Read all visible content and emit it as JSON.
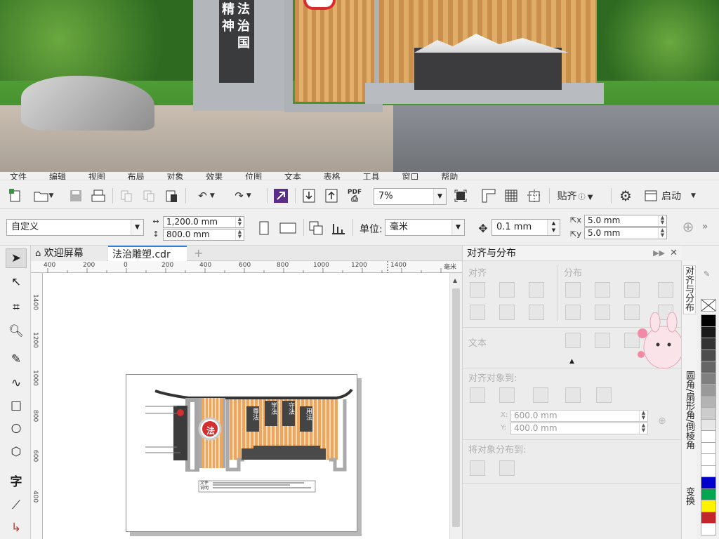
{
  "photo": {
    "slogan_lines": [
      "精",
      "神"
    ],
    "slogan_lines2": [
      "法",
      "治",
      "国"
    ]
  },
  "menubar": {
    "items": [
      "文件",
      "编辑",
      "视图",
      "布局",
      "对象",
      "效果",
      "位图",
      "文本",
      "表格",
      "工具",
      "窗口",
      "帮助"
    ]
  },
  "toolbar": {
    "zoom_value": "7%",
    "snap_label": "贴齐",
    "launch_label": "启动",
    "pdf_label": "PDF"
  },
  "propbar": {
    "page_preset": "自定义",
    "width": "1,200.0 mm",
    "height": "800.0 mm",
    "unit_label": "单位:",
    "unit_value": "毫米",
    "nudge": "0.1 mm",
    "dup_x": "5.0 mm",
    "dup_y": "5.0 mm"
  },
  "tabs": {
    "welcome": "欢迎屏幕",
    "document": "法治雕塑.cdr"
  },
  "ruler": {
    "h_ticks": [
      "400",
      "200",
      "0",
      "200",
      "400",
      "600",
      "800",
      "1000",
      "1200",
      "1400"
    ],
    "h_unit": "毫米",
    "v_ticks": [
      "1400",
      "1200",
      "1000",
      "800",
      "600",
      "400"
    ]
  },
  "drawing": {
    "main_badge": "法",
    "words": [
      "尊法",
      "学法",
      "守法",
      "用法"
    ],
    "label_line1": "文件",
    "label_line2": "说明"
  },
  "docker": {
    "title": "对齐与分布",
    "align_label": "对齐",
    "distribute_label": "分布",
    "text_label": "文本",
    "align_to_label": "对齐对象到:",
    "x_label": "X:",
    "x_value": "600.0 mm",
    "y_label": "Y:",
    "y_value": "400.0 mm",
    "distribute_to_label": "将对象分布到:"
  },
  "vtabs": {
    "tab1": "对齐与分布",
    "tab2": "圆角/扇形角/倒棱角",
    "tab3": "变换"
  },
  "palette": {
    "colors": [
      "#ffffff",
      "#000000",
      "#1a1a1a",
      "#333333",
      "#4d4d4d",
      "#666666",
      "#808080",
      "#999999",
      "#b3b3b3",
      "#cccccc",
      "#e6e6e6",
      "#ffffff",
      "#ffffff",
      "#ffffff",
      "#ffffff",
      "#0000cc",
      "#00a650",
      "#fff200",
      "#c1272d",
      "#ffffff"
    ]
  }
}
